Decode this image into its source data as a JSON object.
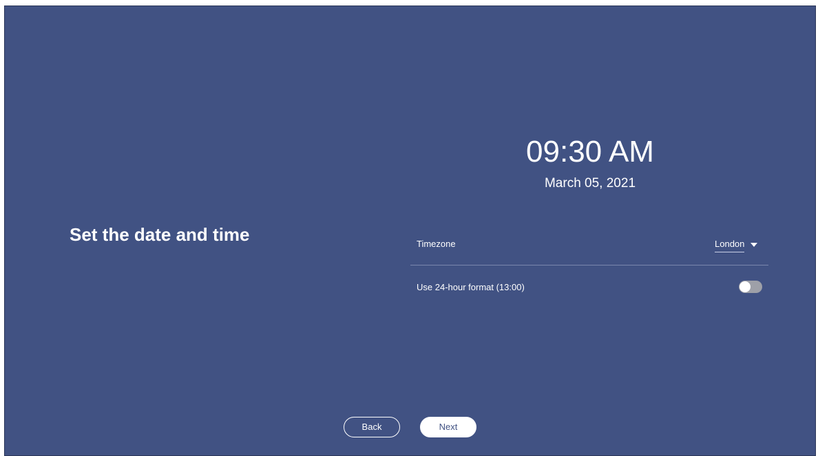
{
  "page": {
    "title": "Set the date and time",
    "background_color": "#415283"
  },
  "clock": {
    "time": "09:30 AM",
    "date": "March 05, 2021"
  },
  "settings": {
    "timezone_label": "Timezone",
    "timezone_value": "London",
    "timezone_icon": "chevron-down-icon",
    "format_label": "Use 24-hour format (13:00)",
    "format_24h_enabled": false
  },
  "buttons": {
    "back_label": "Back",
    "next_label": "Next"
  }
}
